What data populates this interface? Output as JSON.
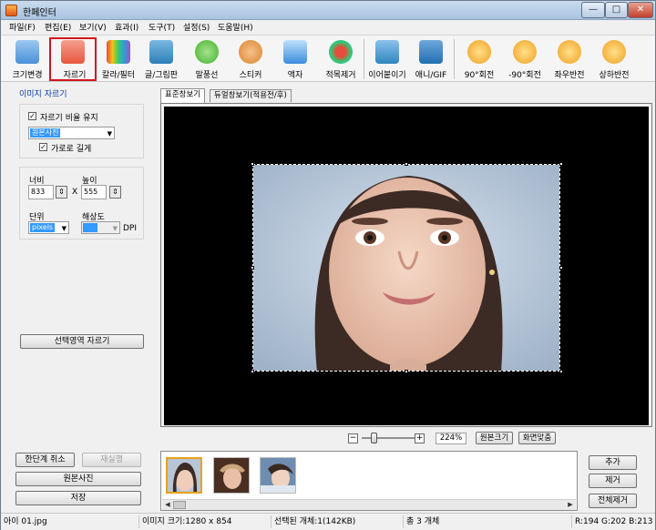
{
  "window": {
    "title": "한페인터",
    "minimize": "—",
    "maximize": "□",
    "close": "✕"
  },
  "menu": [
    "파일(F)",
    "편집(E)",
    "보기(V)",
    "효과(I)",
    "도구(T)",
    "설정(S)",
    "도움말(H)"
  ],
  "toolbar": [
    {
      "label": "크기변경",
      "icon": "resize-icon",
      "color": "#4a90d9"
    },
    {
      "label": "자르기",
      "icon": "crop-icon",
      "color": "#e8553e",
      "selected": true
    },
    {
      "label": "칼라/필터",
      "icon": "color-filter-icon",
      "color": "#9b59b6"
    },
    {
      "label": "글/그림판",
      "icon": "text-drawing-icon",
      "color": "#2c7fb8"
    },
    {
      "label": "말풍선",
      "icon": "speech-bubble-icon",
      "color": "#43b02a"
    },
    {
      "label": "스티커",
      "icon": "sticker-icon",
      "color": "#d9822b"
    },
    {
      "label": "액자",
      "icon": "frame-icon",
      "color": "#3a8dde"
    },
    {
      "label": "적목제거",
      "icon": "red-eye-icon",
      "color": "#e74c3c"
    },
    {
      "label": "이어붙이기",
      "icon": "join-icon",
      "color": "#2e86c1"
    },
    {
      "label": "애니/GIF",
      "icon": "gif-icon",
      "color": "#1f6fb2"
    },
    {
      "label": "90°회전",
      "icon": "rotate-cw-icon",
      "color": "#f0a020"
    },
    {
      "label": "-90°회전",
      "icon": "rotate-ccw-icon",
      "color": "#f0a020"
    },
    {
      "label": "좌우반전",
      "icon": "flip-horizontal-icon",
      "color": "#f0a020"
    },
    {
      "label": "상하반전",
      "icon": "flip-vertical-icon",
      "color": "#f0a020"
    }
  ],
  "left": {
    "section_title": "이미지 자르기",
    "keep_ratio_label": "자르기 비율 유지",
    "ratio_value": "원본사진",
    "landscape_label": "가로로 길게",
    "width_label": "너비",
    "height_label": "높이",
    "width_value": "833",
    "x_sep": "X",
    "height_value": "555",
    "unit_label": "단위",
    "unit_value": "pixels",
    "dpi_label": "해상도",
    "dpi_value": "",
    "dpi_unit": "DPI",
    "crop_selection_button": "선택영역 자르기",
    "undo_button": "한단계 취소",
    "redo_button": "재실행",
    "original_button": "원본사진",
    "save_button": "저장"
  },
  "tabs": [
    "표준창보기",
    "듀얼창보기(적용전/후)"
  ],
  "zoom": {
    "minus": "−",
    "plus": "+",
    "value": "224%",
    "level": 0.2,
    "original_size_button": "원본크기",
    "fit_screen_button": "화면맞춤"
  },
  "right_buttons": {
    "add": "추가",
    "remove": "제거",
    "remove_all": "전체제거"
  },
  "status": {
    "filename": "아이 01.jpg",
    "image_size": "이미지 크기:1280 x 854",
    "selected": "선택된 개체:1(142KB)",
    "total": "총 3 개체",
    "rgb": "R:194 G:202 B:213"
  },
  "colors": {
    "accent_selected": "#d0161e",
    "selection_highlight": "#3399ff",
    "thumb_selected": "#e9a21a"
  }
}
